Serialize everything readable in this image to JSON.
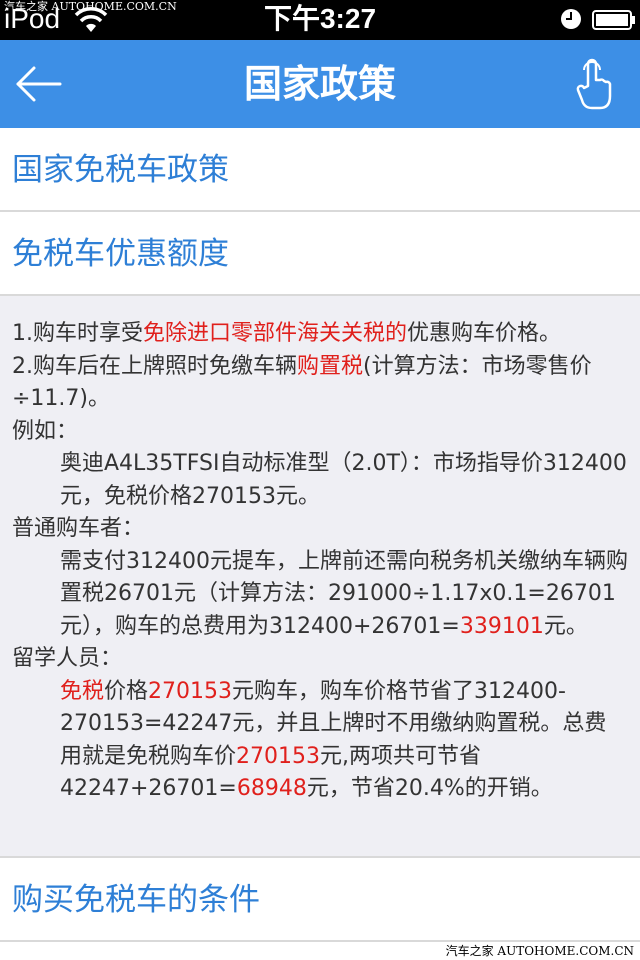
{
  "status_bar": {
    "carrier": "iPod",
    "time": "下午3:27",
    "watermark": "汽车之家 AUTOHOME.COM.CN"
  },
  "nav": {
    "title": "国家政策",
    "back_icon": "arrow-left-icon",
    "right_icon": "hand-pointer-icon",
    "background": "#3d8fe6"
  },
  "sections": [
    {
      "label": "国家免税车政策"
    },
    {
      "label": "免税车优惠额度"
    },
    {
      "label": "购买免税车的条件"
    }
  ],
  "detail": {
    "l1_a": "1.购车时享受",
    "l1_b": "免除进口零部件海关关税的",
    "l1_c": "优惠购车价格。",
    "l2_a": "2.购车后在上牌照时免缴车辆",
    "l2_b": "购置税",
    "l2_c": "(计算方法：市场零售价÷11.7)。",
    "l3": "例如：",
    "l4": "奥迪A4L35TFSI自动标准型（2.0T）：市场指导价312400元，免税价格270153元。",
    "l5": "普通购车者：",
    "l6_a": "需支付312400元提车，上牌前还需向税务机关缴纳车辆购置税26701元（计算方法：291000÷1.17x0.1=26701元），购车的总费用为312400+26701=",
    "l6_b": "339101",
    "l6_c": "元。",
    "l7": "留学人员：",
    "l8_a": "免税",
    "l8_b": "价格",
    "l8_c": "270153",
    "l8_d": "元购车，购车价格节省了312400-270153=42247元，并且上牌时不用缴纳购置税。总费用就是免税购车价",
    "l8_e": "270153",
    "l8_f": "元,两项共可节省42247+26701=",
    "l8_g": "68948",
    "l8_h": "元，节省20.4%的开销。"
  },
  "colors": {
    "accent_text": "#2e7fd6",
    "highlight": "#e0201c",
    "detail_bg": "#efeff4"
  },
  "watermark_bottom": "汽车之家 AUTOHOME.COM.CN"
}
